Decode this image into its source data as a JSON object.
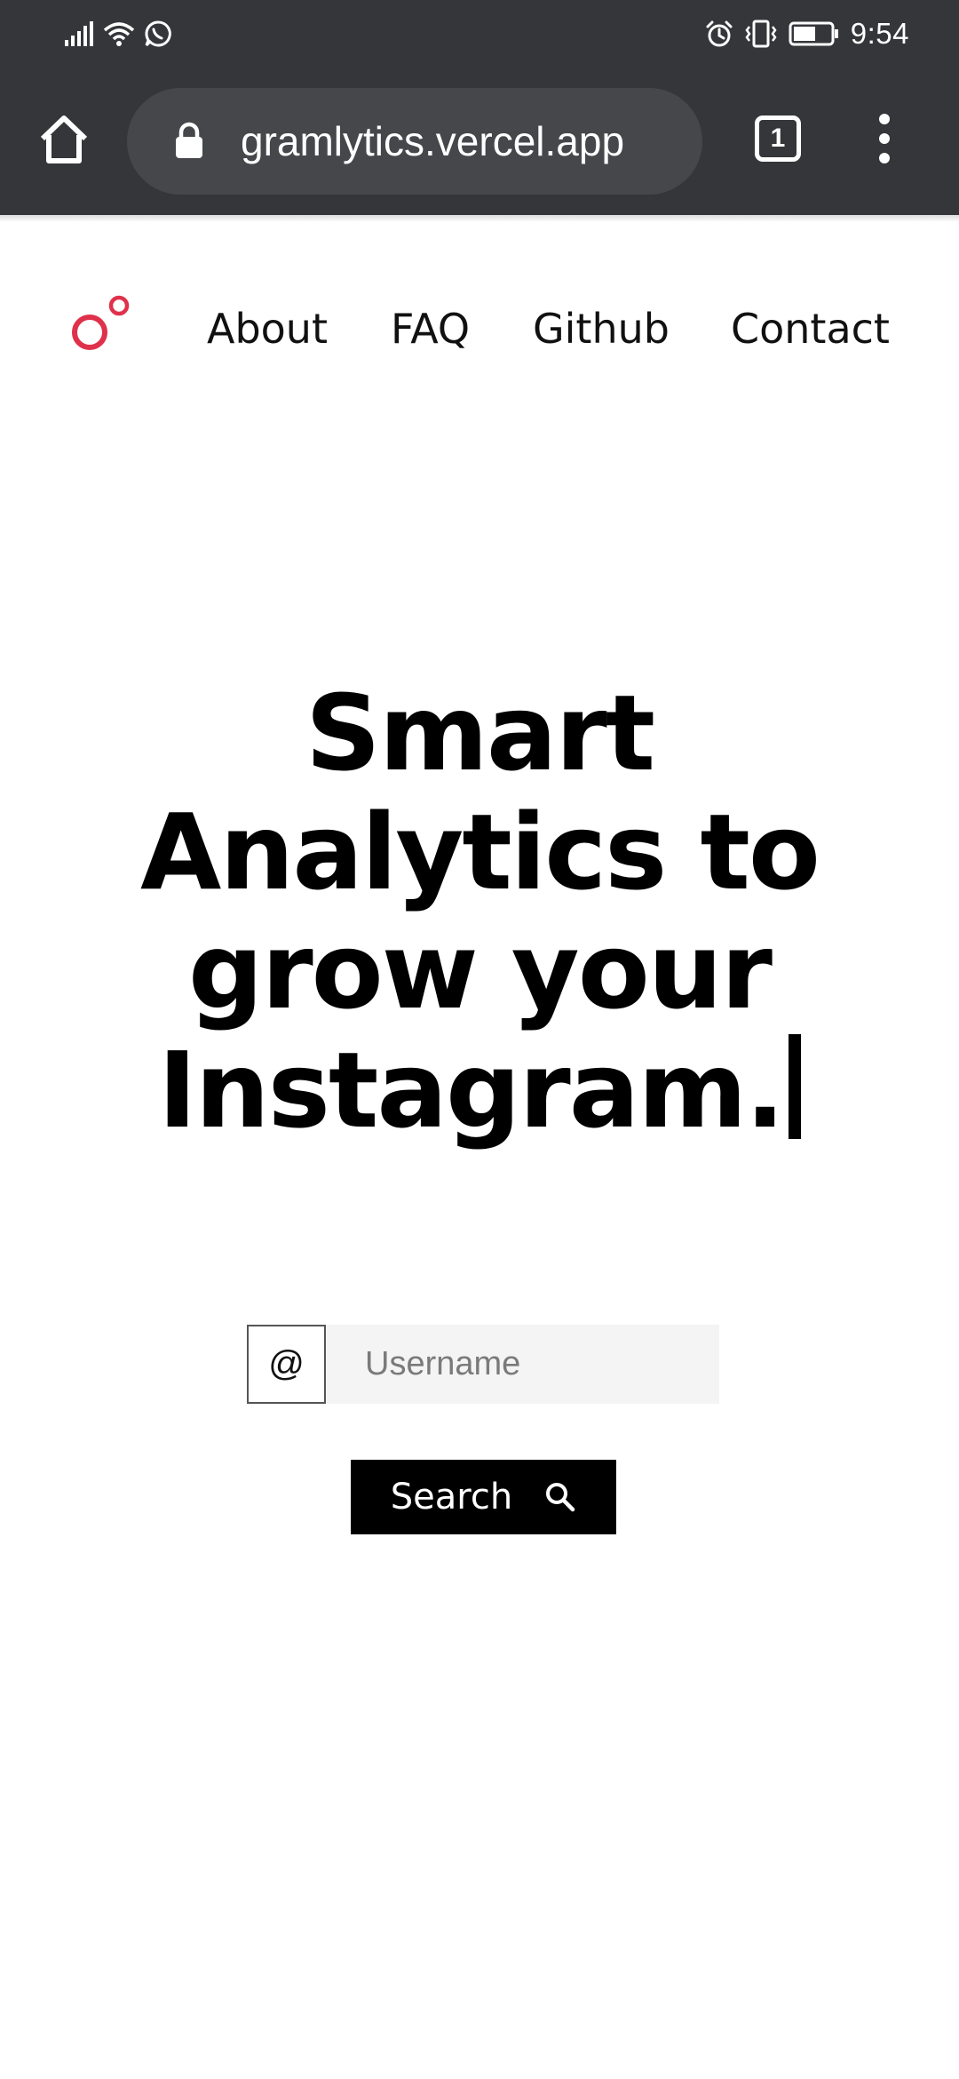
{
  "status_bar": {
    "time": "9:54",
    "icons": [
      "signal-icon",
      "wifi-icon",
      "whatsapp-icon",
      "alarm-icon",
      "vibrate-icon",
      "battery-icon"
    ]
  },
  "browser": {
    "url": "gramlytics.vercel.app",
    "tab_count": "1",
    "icons": [
      "home-icon",
      "lock-icon",
      "tabs-icon",
      "more-menu-icon"
    ]
  },
  "site": {
    "brand_color": "#e0314b",
    "nav": {
      "links": [
        "About",
        "FAQ",
        "Github",
        "Contact"
      ]
    },
    "hero": {
      "lines": [
        "Smart",
        "Analytics to",
        "grow your",
        "Instagram."
      ]
    },
    "search": {
      "at_symbol": "@",
      "placeholder": "Username",
      "button_label": "Search"
    }
  }
}
